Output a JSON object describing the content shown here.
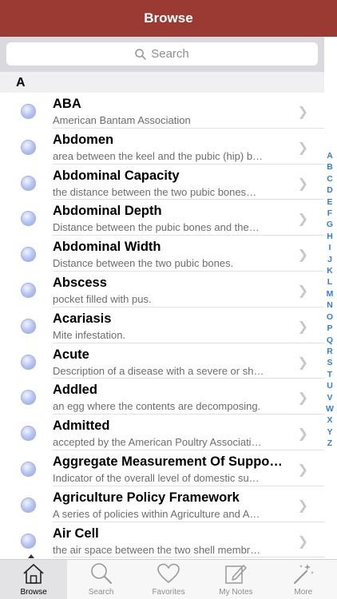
{
  "navbar": {
    "title": "Browse"
  },
  "search": {
    "placeholder": "Search"
  },
  "section": {
    "letter": "A"
  },
  "entries": [
    {
      "term": "ABA",
      "definition": "American Bantam Association"
    },
    {
      "term": "Abdomen",
      "definition": "area between the keel and the pubic (hip) b…"
    },
    {
      "term": "Abdominal Capacity",
      "definition": "the distance between the two pubic bones…"
    },
    {
      "term": "Abdominal Depth",
      "definition": "Distance between the pubic bones and the…"
    },
    {
      "term": "Abdominal Width",
      "definition": "Distance between the two pubic bones."
    },
    {
      "term": "Abscess",
      "definition": "pocket filled with pus."
    },
    {
      "term": "Acariasis",
      "definition": "Mite infestation."
    },
    {
      "term": "Acute",
      "definition": "Description of a disease with a severe or sh…"
    },
    {
      "term": "Addled",
      "definition": "an egg where the contents are decomposing."
    },
    {
      "term": "Admitted",
      "definition": "accepted by the American Poultry Associati…"
    },
    {
      "term": "Aggregate Measurement Of Suppo…",
      "definition": "Indicator of the overall level of domestic su…"
    },
    {
      "term": "Agriculture Policy Framework",
      "definition": "A series of policies within Agriculture and A…"
    },
    {
      "term": "Air Cell",
      "definition": "the air space between the two shell membr…"
    }
  ],
  "index_letters": [
    "A",
    "B",
    "C",
    "D",
    "E",
    "F",
    "G",
    "H",
    "I",
    "J",
    "K",
    "L",
    "M",
    "N",
    "O",
    "P",
    "Q",
    "R",
    "S",
    "T",
    "U",
    "V",
    "W",
    "X",
    "Y",
    "Z"
  ],
  "tabs": [
    {
      "label": "Browse",
      "icon": "home-icon"
    },
    {
      "label": "Search",
      "icon": "magnifier-icon"
    },
    {
      "label": "Favorites",
      "icon": "heart-icon"
    },
    {
      "label": "My Notes",
      "icon": "pencil-note-icon"
    },
    {
      "label": "More",
      "icon": "magic-wand-icon"
    }
  ],
  "colors": {
    "navbar": "#9b3a32",
    "index": "#2f7ee8"
  }
}
